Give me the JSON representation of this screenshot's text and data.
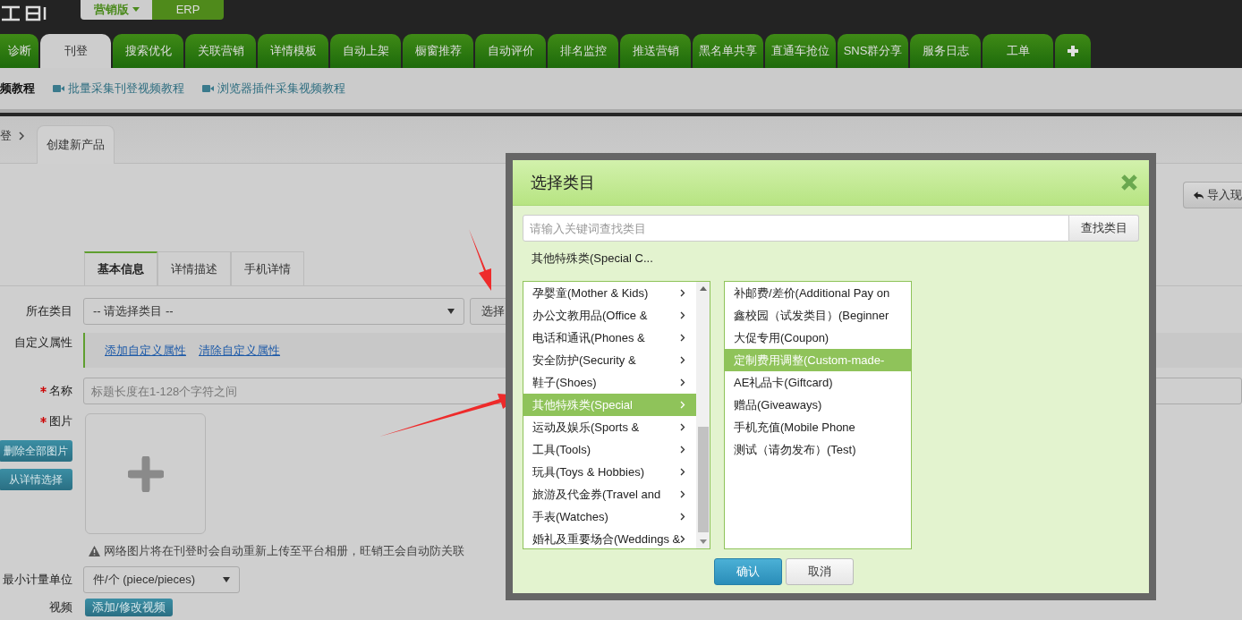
{
  "header": {
    "editions": [
      {
        "label": "营销版",
        "selected": true
      },
      {
        "label": "ERP",
        "selected": false
      }
    ]
  },
  "nav_tabs": [
    {
      "label": "诊断",
      "selected": false
    },
    {
      "label": "刊登",
      "selected": true
    },
    {
      "label": "搜索优化",
      "selected": false
    },
    {
      "label": "关联营销",
      "selected": false
    },
    {
      "label": "详情模板",
      "selected": false
    },
    {
      "label": "自动上架",
      "selected": false
    },
    {
      "label": "橱窗推荐",
      "selected": false
    },
    {
      "label": "自动评价",
      "selected": false
    },
    {
      "label": "排名监控",
      "selected": false
    },
    {
      "label": "推送营销",
      "selected": false
    },
    {
      "label": "黑名单共享",
      "selected": false
    },
    {
      "label": "直通车抢位",
      "selected": false
    },
    {
      "label": "SNS群分享",
      "selected": false
    },
    {
      "label": "服务日志",
      "selected": false
    },
    {
      "label": "工单",
      "selected": false
    }
  ],
  "tutorials": [
    {
      "label": "频教程",
      "kind": "text"
    },
    {
      "label": "批量采集刊登视频教程",
      "kind": "link"
    },
    {
      "label": "浏览器插件采集视频教程",
      "kind": "link"
    }
  ],
  "breadcrumb": {
    "parent": "登",
    "current": "创建新产品"
  },
  "import_button": "导入现",
  "form_tabs": [
    {
      "label": "基本信息",
      "selected": true
    },
    {
      "label": "详情描述",
      "selected": false
    },
    {
      "label": "手机详情",
      "selected": false
    }
  ],
  "form": {
    "category": {
      "label": "所在类目",
      "value": "-- 请选择类目 --",
      "button": "选择"
    },
    "custom_attrs": {
      "label": "自定义属性",
      "links": [
        "添加自定义属性",
        "清除自定义属性"
      ]
    },
    "name": {
      "label": "名称",
      "required": true,
      "placeholder": "标题长度在1-128个字符之间"
    },
    "images": {
      "label": "图片",
      "required": true,
      "buttons": [
        "删除全部图片",
        "从详情选择"
      ],
      "note": "网络图片将在刊登时会自动重新上传至平台相册，旺销王会自动防关联"
    },
    "unit": {
      "label": "最小计量单位",
      "value": "件/个 (piece/pieces)"
    },
    "video": {
      "label": "视频",
      "button": "添加/修改视频"
    }
  },
  "modal": {
    "title": "选择类目",
    "search": {
      "placeholder": "请输入关键词查找类目",
      "button": "查找类目"
    },
    "path": "其他特殊类(Special C...",
    "categories": [
      {
        "label": "孕婴童(Mother & Kids)",
        "selected": false
      },
      {
        "label": "办公文教用品(Office &",
        "selected": false
      },
      {
        "label": "电话和通讯(Phones &",
        "selected": false
      },
      {
        "label": "安全防护(Security &",
        "selected": false
      },
      {
        "label": "鞋子(Shoes)",
        "selected": false
      },
      {
        "label": "其他特殊类(Special",
        "selected": true
      },
      {
        "label": "运动及娱乐(Sports &",
        "selected": false
      },
      {
        "label": "工具(Tools)",
        "selected": false
      },
      {
        "label": "玩具(Toys & Hobbies)",
        "selected": false
      },
      {
        "label": "旅游及代金券(Travel and",
        "selected": false
      },
      {
        "label": "手表(Watches)",
        "selected": false
      },
      {
        "label": "婚礼及重要场合(Weddings &",
        "selected": false
      }
    ],
    "subcategories": [
      {
        "label": "补邮费/差价(Additional Pay on",
        "selected": false
      },
      {
        "label": "鑫校园（试发类目）(Beginner",
        "selected": false
      },
      {
        "label": "大促专用(Coupon)",
        "selected": false
      },
      {
        "label": "定制费用调整(Custom-made-",
        "selected": true
      },
      {
        "label": "AE礼品卡(Giftcard)",
        "selected": false
      },
      {
        "label": "赠品(Giveaways)",
        "selected": false
      },
      {
        "label": "手机充值(Mobile Phone",
        "selected": false
      },
      {
        "label": "测试（请勿发布）(Test)",
        "selected": false
      }
    ],
    "buttons": [
      {
        "label": "确认",
        "kind": "primary"
      },
      {
        "label": "取消",
        "kind": "default"
      }
    ]
  }
}
